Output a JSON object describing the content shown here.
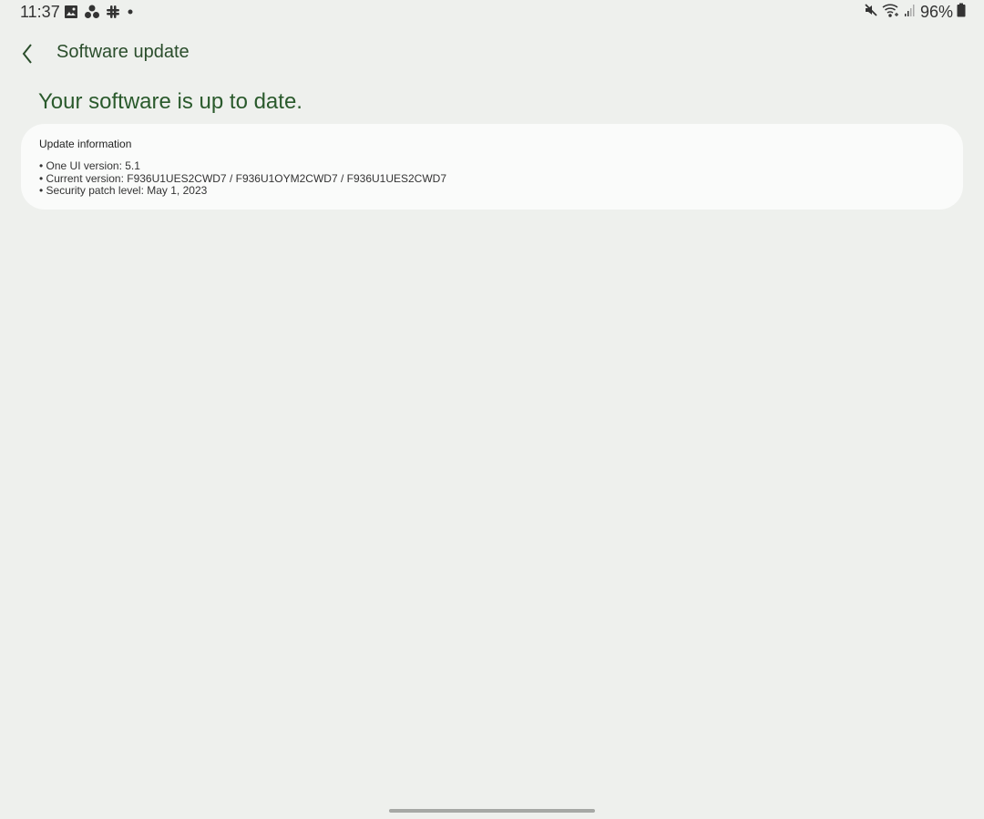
{
  "status_bar": {
    "time": "11:37",
    "left_icons": [
      "gallery-icon",
      "dots-cluster-icon",
      "slack-icon",
      "more-notifications-dot-icon"
    ],
    "right_icons": [
      "mute-icon",
      "wifi-icon",
      "signal-icon",
      "battery-icon"
    ],
    "battery": "96%"
  },
  "header": {
    "back_icon": "chevron-left-icon",
    "title": "Software update"
  },
  "main": {
    "headline": "Your software is up to date.",
    "card": {
      "title": "Update information",
      "items": [
        "• One UI version: 5.1",
        "• Current version: F936U1UES2CWD7 / F936U1OYM2CWD7 / F936U1UES2CWD7",
        "• Security patch level: May 1, 2023"
      ]
    }
  },
  "colors": {
    "background": "#eef0ed",
    "card": "#fafbfa",
    "accent_text": "#2a5a2c"
  }
}
